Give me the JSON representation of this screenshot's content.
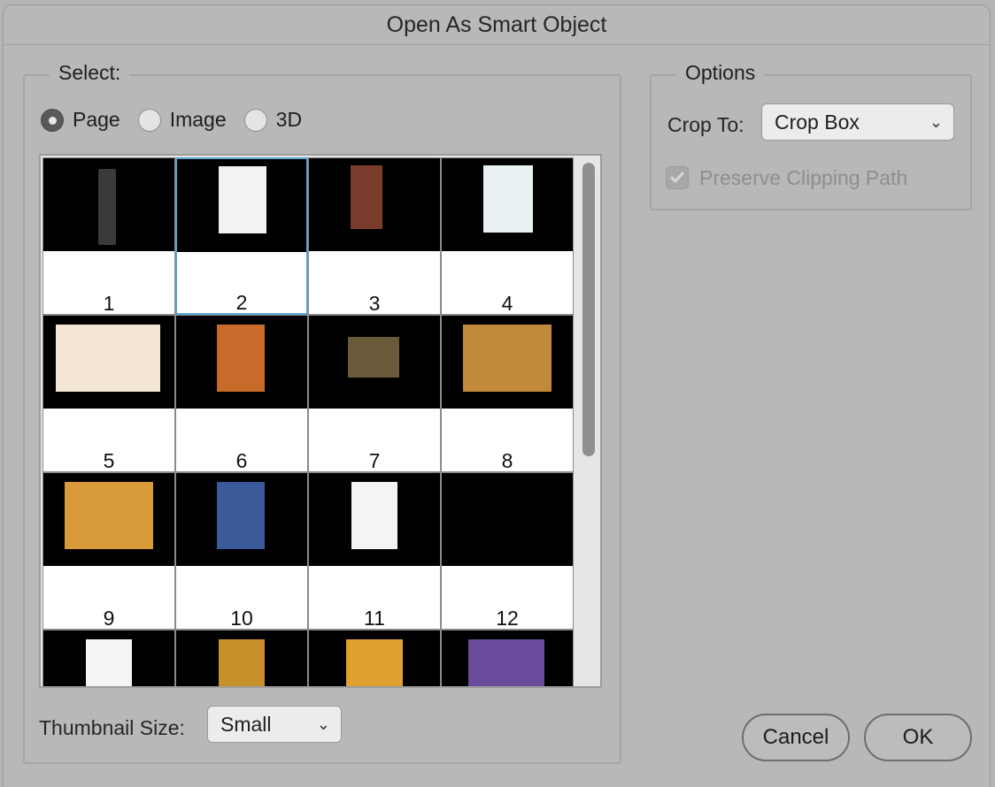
{
  "window": {
    "title": "Open As Smart Object"
  },
  "select_group": {
    "legend": "Select:",
    "options": [
      {
        "label": "Page",
        "selected": true
      },
      {
        "label": "Image",
        "selected": false
      },
      {
        "label": "3D",
        "selected": false
      }
    ]
  },
  "pages": [
    {
      "number": "1",
      "selected": false
    },
    {
      "number": "2",
      "selected": true
    },
    {
      "number": "3",
      "selected": false
    },
    {
      "number": "4",
      "selected": false
    },
    {
      "number": "5",
      "selected": false
    },
    {
      "number": "6",
      "selected": false
    },
    {
      "number": "7",
      "selected": false
    },
    {
      "number": "8",
      "selected": false
    },
    {
      "number": "9",
      "selected": false
    },
    {
      "number": "10",
      "selected": false
    },
    {
      "number": "11",
      "selected": false
    },
    {
      "number": "12",
      "selected": false
    },
    {
      "number": "",
      "selected": false
    },
    {
      "number": "",
      "selected": false
    },
    {
      "number": "",
      "selected": false
    },
    {
      "number": "",
      "selected": false
    }
  ],
  "thumbnail_size": {
    "label": "Thumbnail Size:",
    "value": "Small"
  },
  "options_group": {
    "legend": "Options",
    "crop_to_label": "Crop To:",
    "crop_to_value": "Crop Box",
    "preserve_clipping_label": "Preserve Clipping Path",
    "preserve_clipping_checked": true
  },
  "buttons": {
    "cancel": "Cancel",
    "ok": "OK"
  },
  "colors": {
    "selection_border": "#5aa3cf",
    "dialog_bg": "#b8b8b8"
  }
}
